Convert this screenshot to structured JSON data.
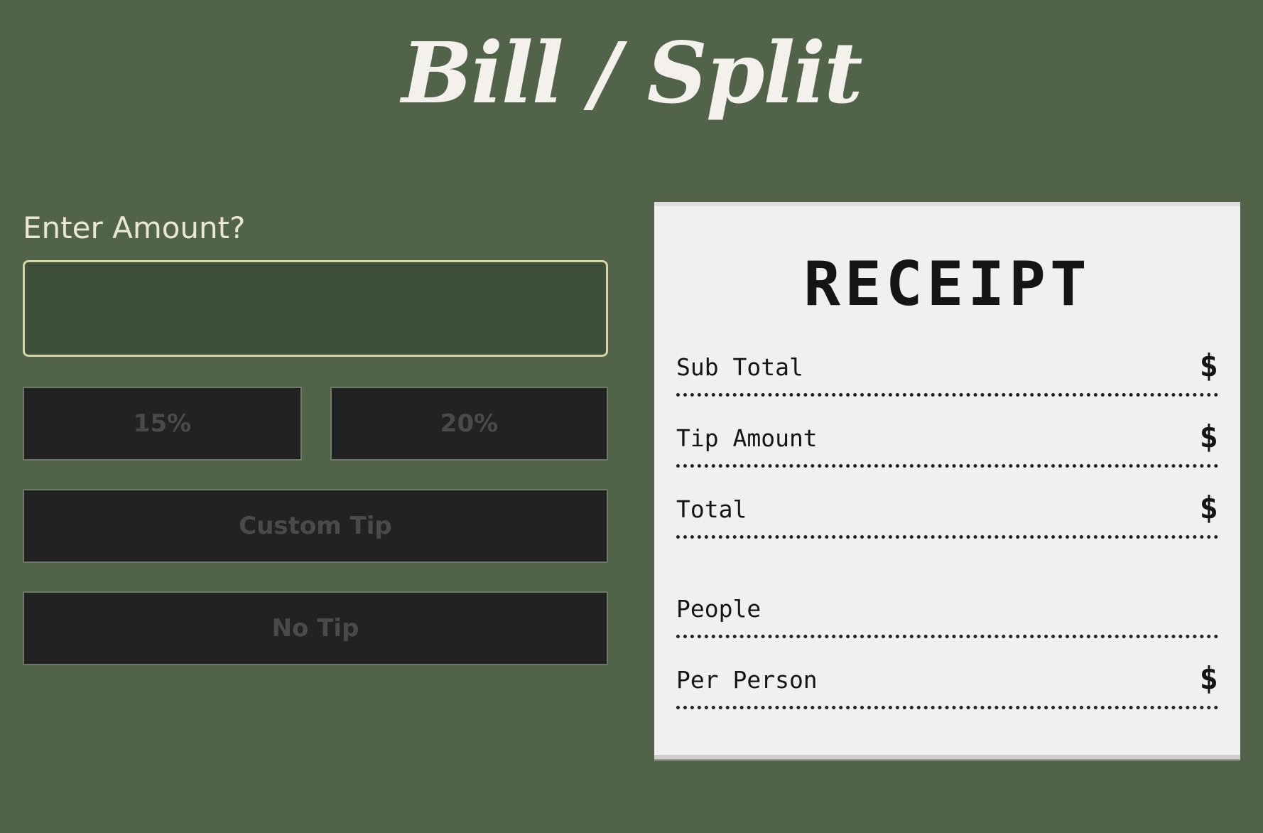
{
  "app": {
    "title": "Bill / Split"
  },
  "amount": {
    "label": "Enter Amount?",
    "value": "",
    "placeholder": ""
  },
  "tips": {
    "fifteen": "15%",
    "twenty": "20%",
    "custom": "Custom Tip",
    "none": "No Tip"
  },
  "receipt": {
    "title": "RECEIPT",
    "rows": [
      {
        "label": "Sub Total",
        "value": "$"
      },
      {
        "label": "Tip Amount",
        "value": "$"
      },
      {
        "label": "Total",
        "value": "$"
      },
      {
        "label": "People",
        "value": ""
      },
      {
        "label": "Per Person",
        "value": "$"
      }
    ]
  },
  "colors": {
    "background": "#516449",
    "title_text": "#f4f1ec",
    "input_border": "#d8d3a4",
    "input_fill": "#3f503a",
    "button_fill": "#222222",
    "button_text": "#4a4a4a",
    "receipt_paper": "#f1eff0",
    "receipt_text": "#151515"
  }
}
